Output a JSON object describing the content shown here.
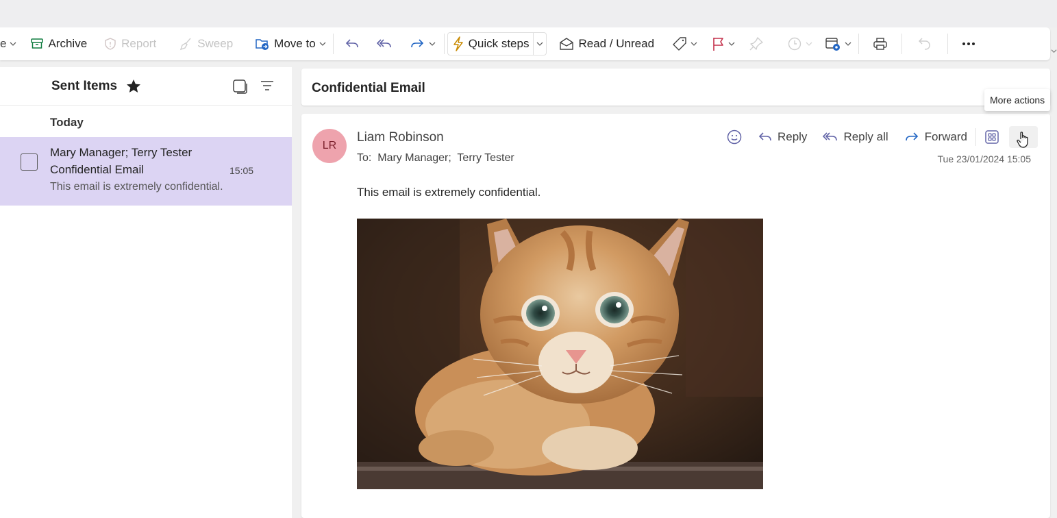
{
  "ribbon": {
    "archive": "Archive",
    "report": "Report",
    "sweep": "Sweep",
    "move_to": "Move to",
    "quick_steps": "Quick steps",
    "read_unread": "Read / Unread"
  },
  "folder": {
    "title": "Sent Items",
    "group": "Today"
  },
  "messages": [
    {
      "from": "Mary Manager; Terry Tester",
      "subject": "Confidential Email",
      "time": "15:05",
      "preview": "This email is extremely confidential."
    }
  ],
  "email": {
    "subject": "Confidential Email",
    "sender_initials": "LR",
    "sender": "Liam Robinson",
    "to_label": "To:",
    "to": "Mary Manager;  Terry Tester",
    "date": "Tue 23/01/2024 15:05",
    "body": "This email is extremely confidential.",
    "reply": "Reply",
    "reply_all": "Reply all",
    "forward": "Forward"
  },
  "tooltip": "More actions",
  "colors": {
    "selected_item": "#dcd4f3",
    "accent": "#6264a7",
    "avatar_bg": "#eea3ad",
    "flag": "#c4314b"
  }
}
